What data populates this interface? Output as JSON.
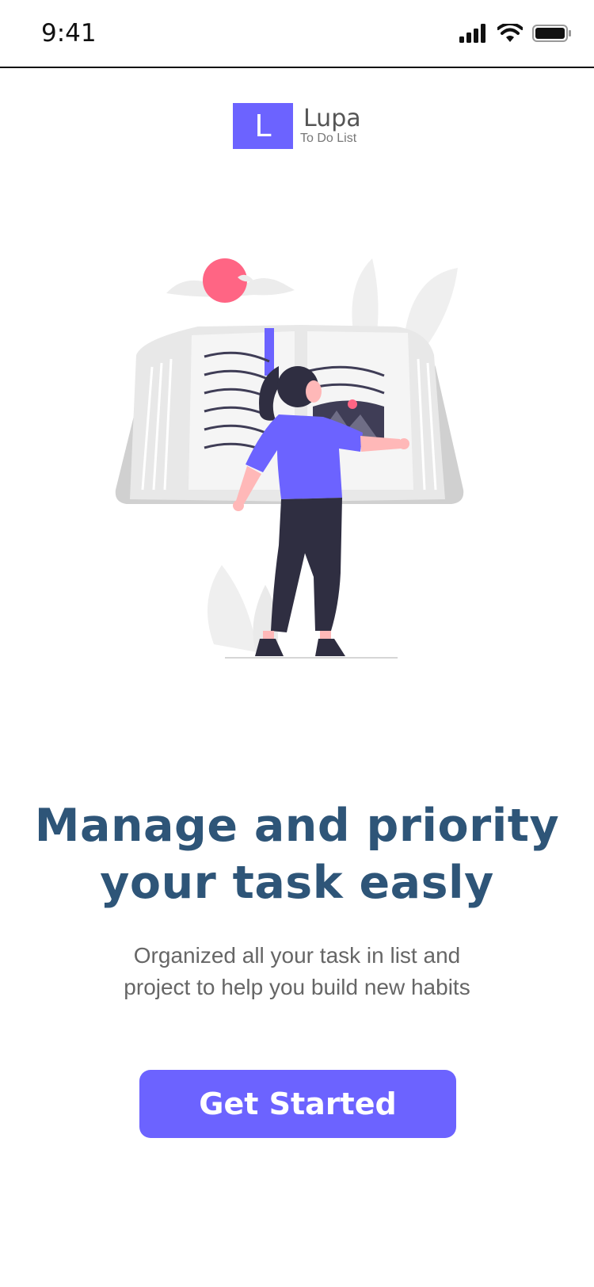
{
  "status_bar": {
    "time": "9:41"
  },
  "logo": {
    "letter": "L",
    "name": "Lupa",
    "tagline": "To Do List"
  },
  "illustration": {
    "icon": "woman-reading-book-illustration"
  },
  "onboarding": {
    "headline_line1": "Manage and priority",
    "headline_line2": "your task easly",
    "subtext_line1": "Organized all your task in list and",
    "subtext_line2": "project to help you build new habits",
    "cta_label": "Get Started"
  },
  "colors": {
    "accent": "#6c63ff",
    "headline": "#2e5578",
    "sun": "#ff6584"
  }
}
